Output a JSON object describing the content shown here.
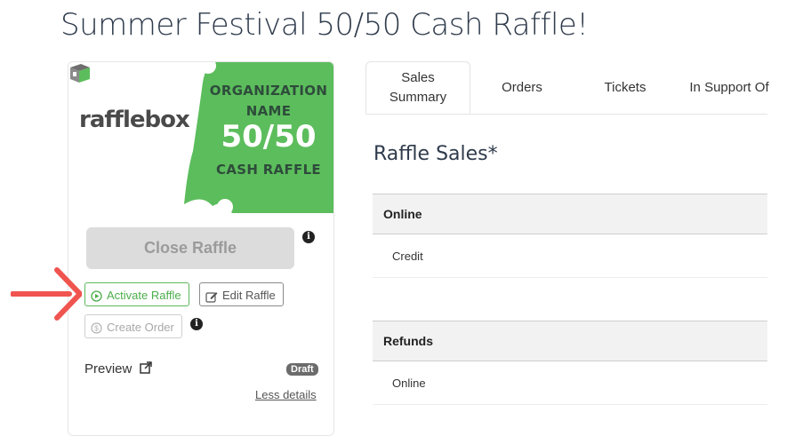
{
  "page": {
    "title": "Summer Festival 50/50 Cash Raffle!"
  },
  "banner": {
    "logo_text": "rafflebox",
    "org_line1": "ORGANIZATION",
    "org_line2": "NAME",
    "big_text": "50/50",
    "sub_text": "CASH RAFFLE",
    "green": "#5cbd5c"
  },
  "actions": {
    "close_label": "Close Raffle",
    "activate_label": "Activate Raffle",
    "edit_label": "Edit Raffle",
    "create_label": "Create Order",
    "info_glyph": "i"
  },
  "footer": {
    "preview_label": "Preview",
    "status_badge": "Draft",
    "less_details": "Less details"
  },
  "tabs": [
    {
      "label": "Sales Summary",
      "active": true
    },
    {
      "label": "Orders",
      "active": false
    },
    {
      "label": "Tickets",
      "active": false
    },
    {
      "label": "In Support Of",
      "active": false
    }
  ],
  "sales": {
    "title": "Raffle Sales*",
    "groups": [
      {
        "header": "Online",
        "items": [
          "Credit",
          ""
        ]
      },
      {
        "header": "Refunds",
        "items": [
          "Online"
        ]
      }
    ]
  },
  "colors": {
    "accent_green": "#5cb85c",
    "arrow_red": "#f0544f",
    "title_color": "#2f3b4c"
  }
}
